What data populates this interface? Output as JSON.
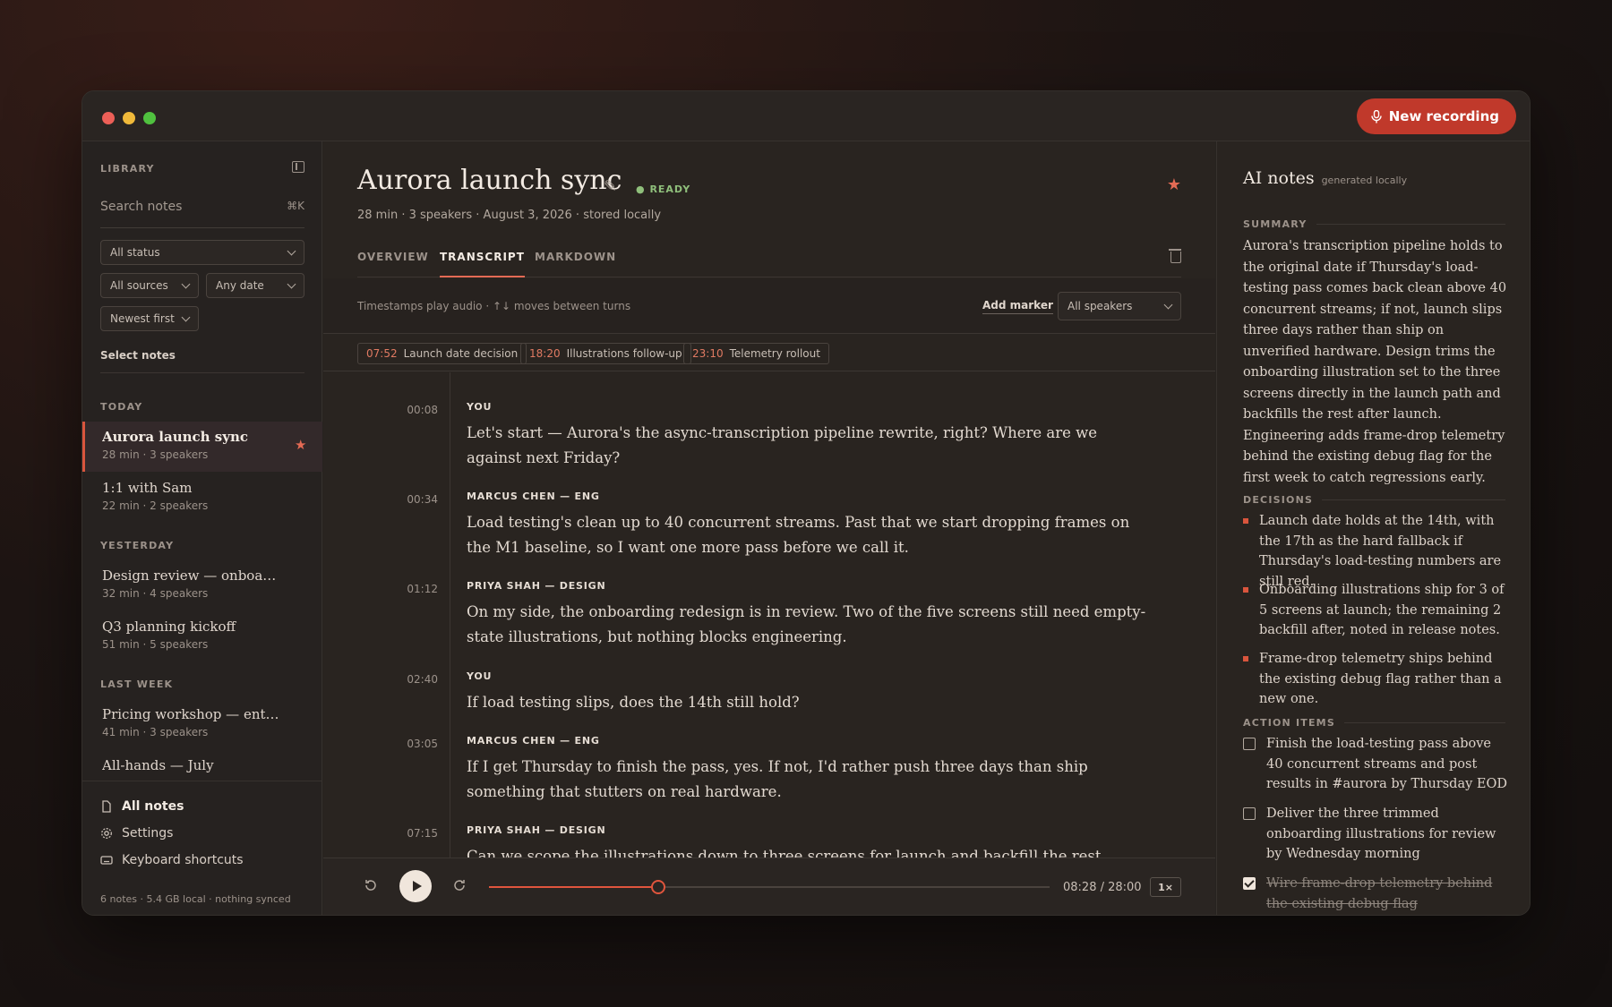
{
  "app": {
    "new_recording": "New recording"
  },
  "sidebar": {
    "library_label": "LIBRARY",
    "search_placeholder": "Search notes",
    "search_shortcut": "⌘K",
    "filters": {
      "status": "All status",
      "sources": "All sources",
      "date": "Any date",
      "sort": "Newest first"
    },
    "select_notes": "Select notes",
    "groups": [
      {
        "label": "TODAY",
        "items": [
          {
            "title": "Aurora launch sync",
            "meta": "28 min · 3 speakers",
            "active": true,
            "starred": true
          },
          {
            "title": "1:1 with Sam",
            "meta": "22 min · 2 speakers"
          }
        ]
      },
      {
        "label": "YESTERDAY",
        "items": [
          {
            "title": "Design review — onboardi…",
            "meta": "32 min · 4 speakers"
          },
          {
            "title": "Q3 planning kickoff",
            "meta": "51 min · 5 speakers"
          }
        ]
      },
      {
        "label": "LAST WEEK",
        "items": [
          {
            "title": "Pricing workshop — enter…",
            "meta": "41 min · 3 speakers"
          },
          {
            "title": "All-hands — July",
            "meta": ""
          }
        ]
      }
    ],
    "footer": {
      "all_notes": "All notes",
      "settings": "Settings",
      "shortcuts": "Keyboard shortcuts",
      "storage": "6 notes · 5.4 GB local · nothing synced"
    }
  },
  "note": {
    "title": "Aurora launch sync",
    "status": "READY",
    "meta": "28 min · 3 speakers · August 3, 2026 · stored locally",
    "tabs": [
      "OVERVIEW",
      "TRANSCRIPT",
      "MARKDOWN"
    ],
    "active_tab": "TRANSCRIPT",
    "hint": "Timestamps play audio · ↑↓ moves between turns",
    "add_marker": "Add marker",
    "speaker_filter": "All speakers",
    "chapters": [
      {
        "time": "07:52",
        "label": "Launch date decision"
      },
      {
        "time": "18:20",
        "label": "Illustrations follow-up"
      },
      {
        "time": "23:10",
        "label": "Telemetry rollout"
      }
    ],
    "turns": [
      {
        "time": "00:08",
        "speaker": "YOU",
        "text": "Let's start — Aurora's the async-transcription pipeline rewrite, right? Where are we against next Friday?"
      },
      {
        "time": "00:34",
        "speaker": "MARCUS CHEN — ENG",
        "text": "Load testing's clean up to 40 concurrent streams. Past that we start dropping frames on the M1 baseline, so I want one more pass before we call it."
      },
      {
        "time": "01:12",
        "speaker": "PRIYA SHAH — DESIGN",
        "text": "On my side, the onboarding redesign is in review. Two of the five screens still need empty-state illustrations, but nothing blocks engineering."
      },
      {
        "time": "02:40",
        "speaker": "YOU",
        "text": "If load testing slips, does the 14th still hold?"
      },
      {
        "time": "03:05",
        "speaker": "MARCUS CHEN — ENG",
        "text": "If I get Thursday to finish the pass, yes. If not, I'd rather push three days than ship something that stutters on real hardware."
      },
      {
        "time": "07:15",
        "speaker": "PRIYA SHAH — DESIGN",
        "text": "Can we scope the illustrations down to three screens for launch and backfill the rest after? That"
      }
    ],
    "player": {
      "elapsed": "08:28",
      "total": "28:00",
      "clock": "08:28 / 28:00",
      "progress": 0.302,
      "speed": "1×"
    }
  },
  "ai": {
    "title": "AI notes",
    "subtitle": "generated locally",
    "summary_label": "SUMMARY",
    "summary": "Aurora's transcription pipeline holds to the original date if Thursday's load-testing pass comes back clean above 40 concurrent streams; if not, launch slips three days rather than ship on unverified hardware. Design trims the onboarding illustration set to the three screens directly in the launch path and backfills the rest after launch. Engineering adds frame-drop telemetry behind the existing debug flag for the first week to catch regressions early.",
    "decisions_label": "DECISIONS",
    "decisions": [
      "Launch date holds at the 14th, with the 17th as the hard fallback if Thursday's load-testing numbers are still red.",
      "Onboarding illustrations ship for 3 of 5 screens at launch; the remaining 2 backfill after, noted in release notes.",
      "Frame-drop telemetry ships behind the existing debug flag rather than a new one."
    ],
    "actions_label": "ACTION ITEMS",
    "actions": [
      {
        "text": "Finish the load-testing pass above 40 concurrent streams and post results in #aurora by Thursday EOD",
        "done": false
      },
      {
        "text": "Deliver the three trimmed onboarding illustrations for review by Wednesday morning",
        "done": false
      },
      {
        "text": "Wire frame-drop telemetry behind the existing debug flag",
        "done": true
      }
    ]
  },
  "colors": {
    "accent": "#c0392b",
    "ready": "#8fbf7b",
    "star": "#e46a54"
  }
}
